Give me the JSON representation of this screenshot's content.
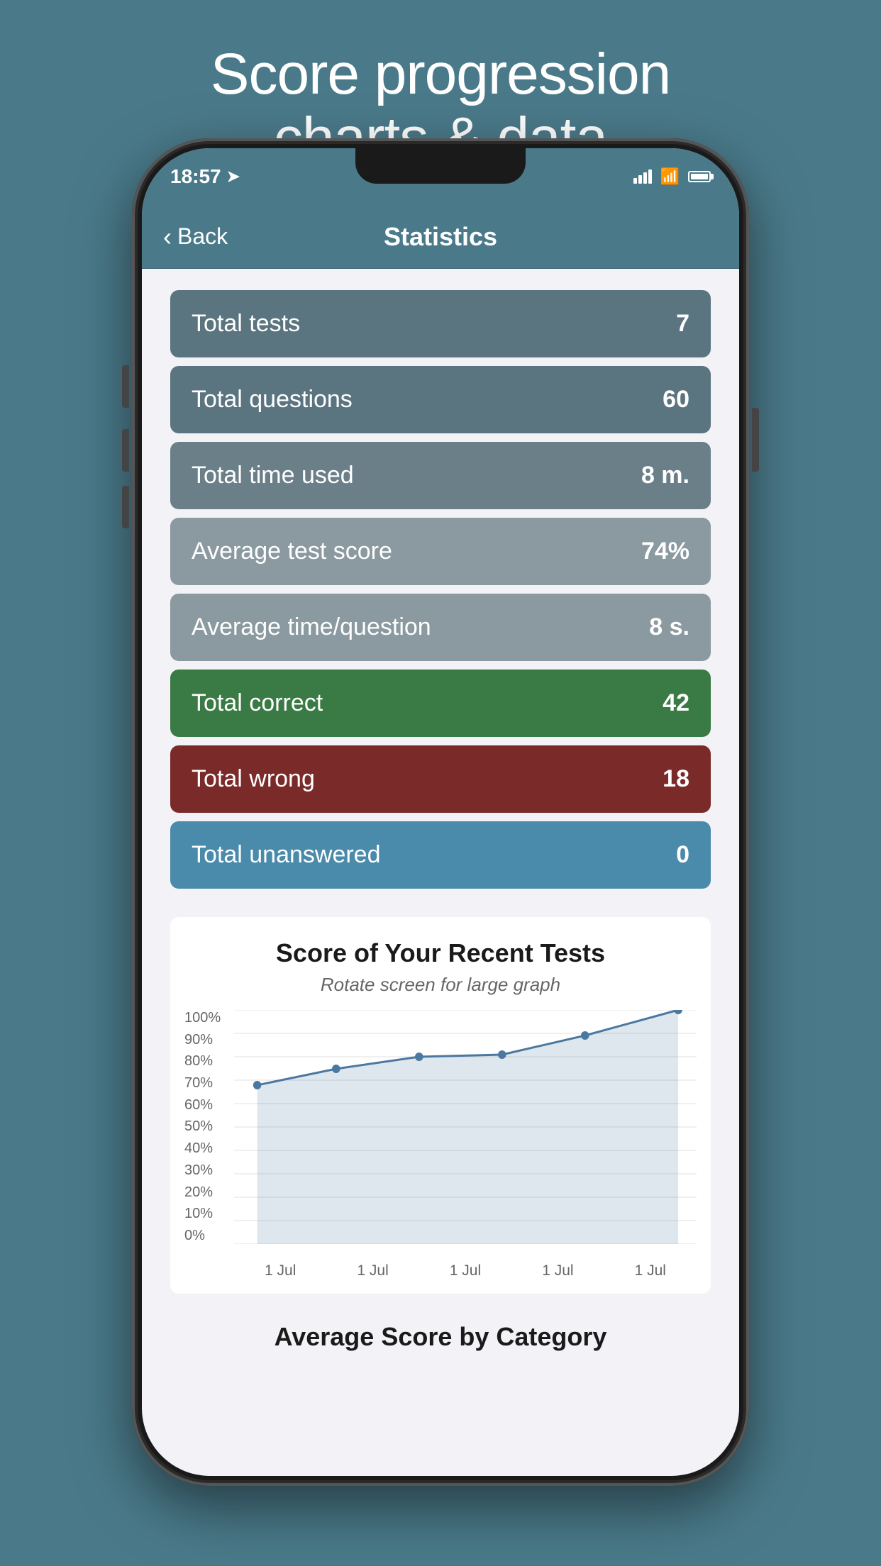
{
  "page": {
    "title_line1": "Score progression",
    "title_line2": "charts & data"
  },
  "status_bar": {
    "time": "18:57",
    "location_icon": "location-icon"
  },
  "nav": {
    "back_label": "Back",
    "title": "Statistics"
  },
  "stats": [
    {
      "label": "Total tests",
      "value": "7",
      "color_class": "dark-slate"
    },
    {
      "label": "Total questions",
      "value": "60",
      "color_class": "dark-slate"
    },
    {
      "label": "Total time used",
      "value": "8 m.",
      "color_class": "mid-slate"
    },
    {
      "label": "Average test score",
      "value": "74%",
      "color_class": "light-slate"
    },
    {
      "label": "Average time/question",
      "value": "8 s.",
      "color_class": "light-slate"
    },
    {
      "label": "Total correct",
      "value": "42",
      "color_class": "green"
    },
    {
      "label": "Total wrong",
      "value": "18",
      "color_class": "red"
    },
    {
      "label": "Total unanswered",
      "value": "0",
      "color_class": "teal"
    }
  ],
  "chart": {
    "title": "Score of Your Recent Tests",
    "subtitle": "Rotate screen for large graph",
    "y_axis_labels": [
      "100%",
      "90%",
      "80%",
      "70%",
      "60%",
      "50%",
      "40%",
      "30%",
      "20%",
      "10%",
      "0%"
    ],
    "x_axis_labels": [
      "1 Jul",
      "1 Jul",
      "1 Jul",
      "1 Jul",
      "1 Jul"
    ],
    "data_points": [
      {
        "x_pct": 5,
        "y_pct": 32
      },
      {
        "x_pct": 22,
        "y_pct": 25
      },
      {
        "x_pct": 40,
        "y_pct": 20
      },
      {
        "x_pct": 58,
        "y_pct": 19
      },
      {
        "x_pct": 76,
        "y_pct": 11
      },
      {
        "x_pct": 96,
        "y_pct": 0
      }
    ]
  },
  "avg_by_category": {
    "title": "Average Score by Category"
  }
}
